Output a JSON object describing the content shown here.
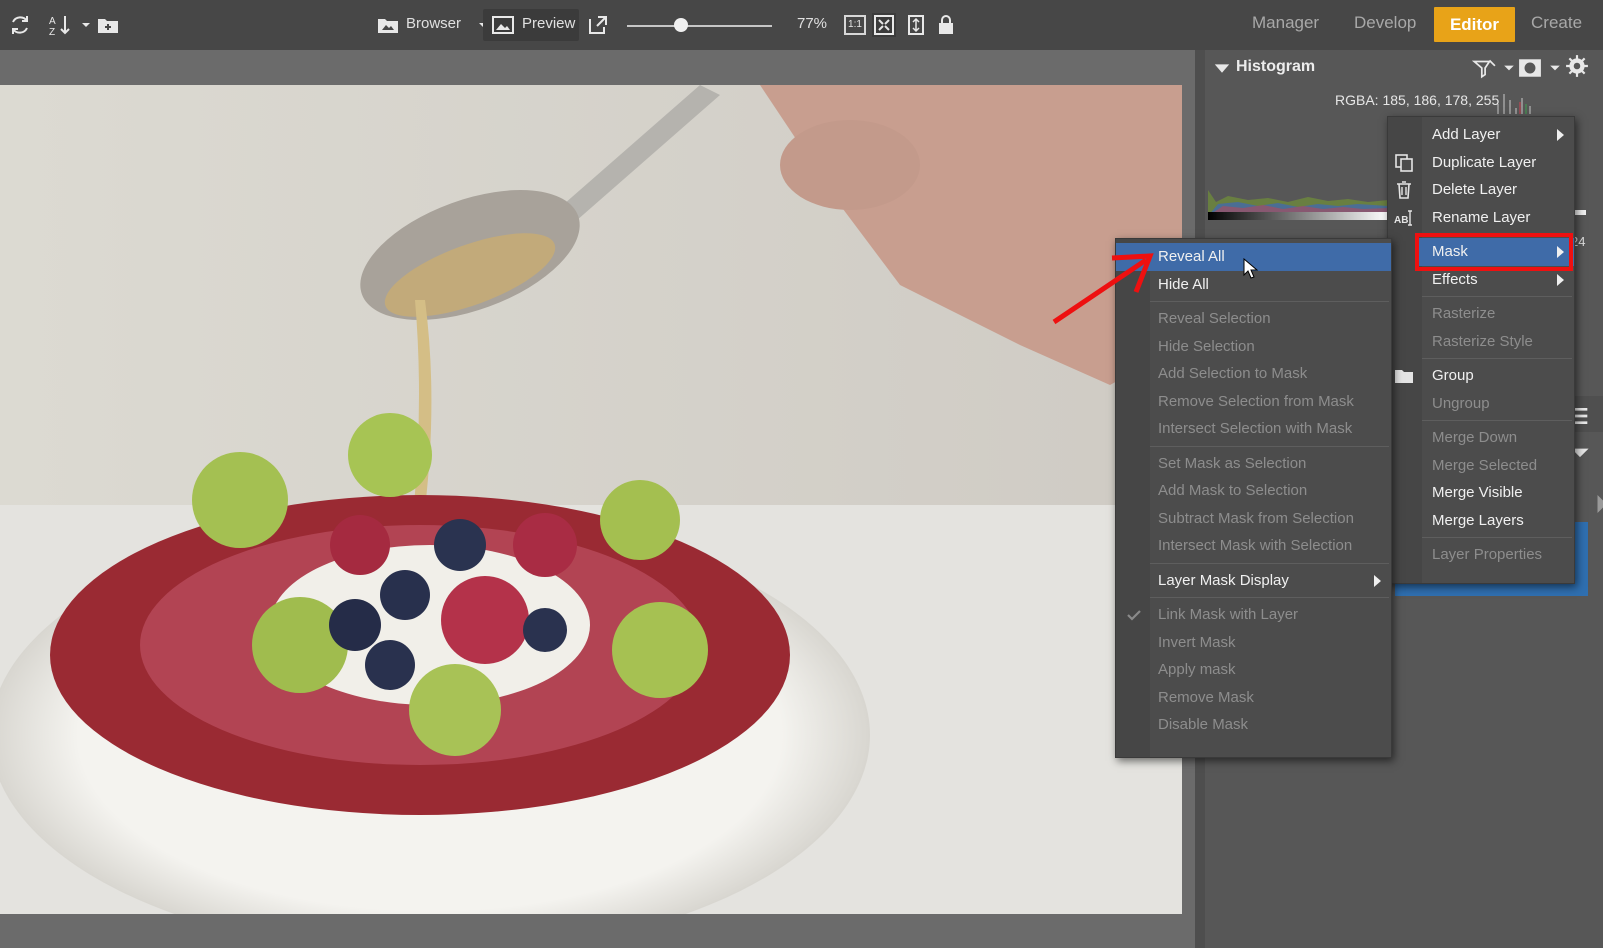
{
  "toolbar": {
    "browser_label": "Browser",
    "preview_label": "Preview",
    "zoom": "77%",
    "one_to_one": "1:1",
    "modes": [
      "Manager",
      "Develop",
      "Editor",
      "Create"
    ],
    "active_mode": "Editor"
  },
  "histogram": {
    "title": "Histogram",
    "rgba": "RGBA: 185, 186, 178, 255",
    "side_value": "24"
  },
  "layer_menu": {
    "items": [
      {
        "label": "Add Layer",
        "enabled": true,
        "submenu": true
      },
      {
        "label": "Duplicate Layer",
        "enabled": true,
        "icon": "duplicate-icon"
      },
      {
        "label": "Delete Layer",
        "enabled": true,
        "icon": "trash-icon"
      },
      {
        "label": "Rename Layer",
        "enabled": true,
        "icon": "rename-icon"
      },
      {
        "label": "Mask",
        "enabled": true,
        "submenu": true,
        "highlighted": true
      },
      {
        "label": "Effects",
        "enabled": true,
        "submenu": true
      },
      {
        "label": "Rasterize",
        "enabled": false
      },
      {
        "label": "Rasterize Style",
        "enabled": false
      },
      {
        "label": "Group",
        "enabled": true,
        "icon": "folder-icon"
      },
      {
        "label": "Ungroup",
        "enabled": false
      },
      {
        "label": "Merge Down",
        "enabled": false
      },
      {
        "label": "Merge Selected",
        "enabled": false
      },
      {
        "label": "Merge Visible",
        "enabled": true
      },
      {
        "label": "Merge Layers",
        "enabled": true
      },
      {
        "label": "Layer Properties",
        "enabled": false
      }
    ]
  },
  "mask_menu": {
    "items": [
      {
        "label": "Reveal All",
        "enabled": true,
        "highlighted": true
      },
      {
        "label": "Hide All",
        "enabled": true
      },
      {
        "label": "Reveal Selection",
        "enabled": false
      },
      {
        "label": "Hide Selection",
        "enabled": false
      },
      {
        "label": "Add Selection to Mask",
        "enabled": false
      },
      {
        "label": "Remove Selection from Mask",
        "enabled": false
      },
      {
        "label": "Intersect Selection with Mask",
        "enabled": false
      },
      {
        "label": "Set Mask as Selection",
        "enabled": false
      },
      {
        "label": "Add Mask to Selection",
        "enabled": false
      },
      {
        "label": "Subtract Mask from Selection",
        "enabled": false
      },
      {
        "label": "Intersect Mask with Selection",
        "enabled": false
      },
      {
        "label": "Layer Mask Display",
        "enabled": true,
        "submenu": true
      },
      {
        "label": "Link Mask with Layer",
        "enabled": false,
        "checked": true
      },
      {
        "label": "Invert Mask",
        "enabled": false
      },
      {
        "label": "Apply mask",
        "enabled": false
      },
      {
        "label": "Remove Mask",
        "enabled": false
      },
      {
        "label": "Disable Mask",
        "enabled": false
      }
    ]
  },
  "colors": {
    "accent": "#e8a318",
    "highlight": "#3f6ba8",
    "annotation": "#ee1010"
  }
}
